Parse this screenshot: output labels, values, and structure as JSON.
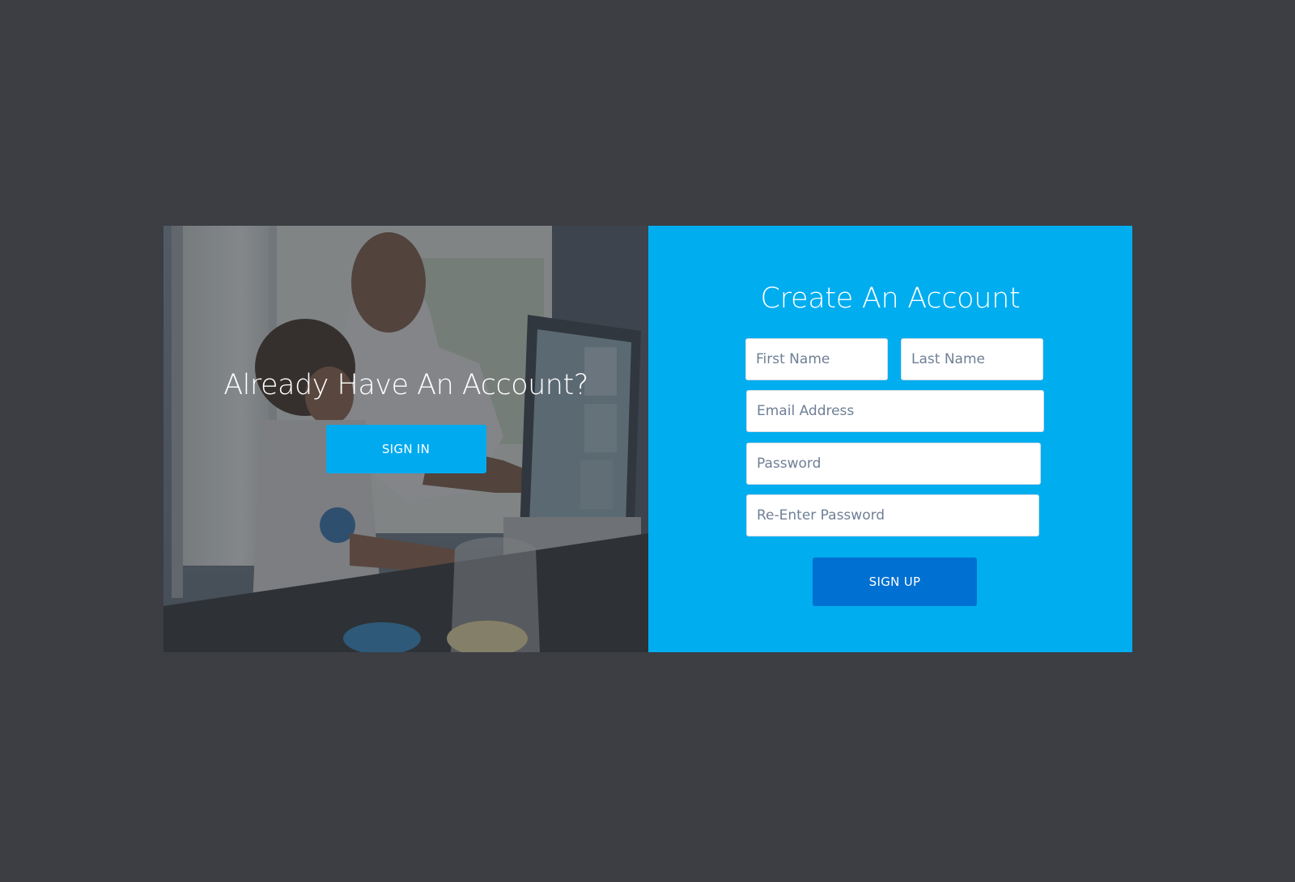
{
  "sign_in_panel": {
    "title": "Already Have An Account?",
    "sign_in_label": "SIGN IN",
    "background": "photo of an adult and a child looking at a computer monitor"
  },
  "sign_up_panel": {
    "title": "Create An Account",
    "fields": {
      "first_name": {
        "placeholder": "First Name",
        "value": ""
      },
      "last_name": {
        "placeholder": "Last Name",
        "value": ""
      },
      "email": {
        "placeholder": "Email Address",
        "value": ""
      },
      "password": {
        "placeholder": "Password",
        "value": ""
      },
      "reenter_password": {
        "placeholder": "Re-Enter Password",
        "value": ""
      }
    },
    "sign_up_label": "SIGN UP"
  },
  "colors": {
    "page_background": "#3c3e44",
    "form_panel": "#00adef",
    "sign_in_button": "#00aaee",
    "sign_up_button": "#0070d2",
    "field_text": "#6f7f95"
  }
}
